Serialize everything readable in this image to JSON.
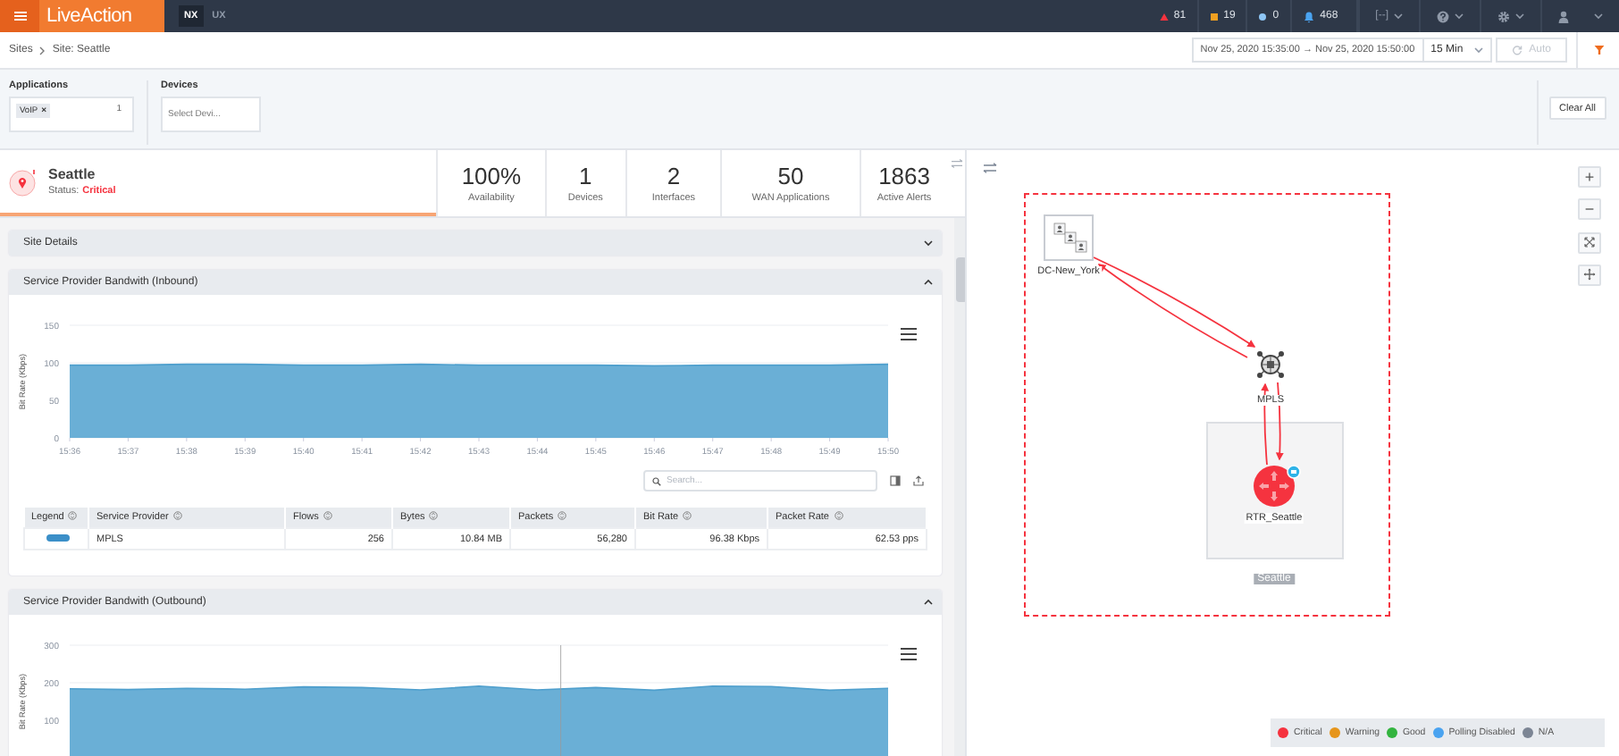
{
  "top_bar": {
    "logo": "LiveAction",
    "tabs": [
      {
        "label": "NX",
        "selected": true
      },
      {
        "label": "UX",
        "selected": false
      }
    ],
    "alerts": [
      {
        "kind": "critical",
        "count": "81"
      },
      {
        "kind": "warning",
        "count": "19"
      },
      {
        "kind": "info",
        "count": "0"
      },
      {
        "kind": "notifications",
        "count": "468"
      }
    ],
    "bracket_menu": "[--]"
  },
  "breadcrumb": [
    "Sites",
    "Site: Seattle"
  ],
  "time_range": {
    "value": "Nov 25, 2020 15:35:00 → Nov 25, 2020 15:50:00",
    "interval": "15 Min",
    "auto": {
      "label": "Auto",
      "disabled": true
    }
  },
  "filters": {
    "applications": {
      "label": "Applications",
      "chips": [
        {
          "label": "VoIP",
          "remove": "×"
        }
      ],
      "count": "1"
    },
    "devices": {
      "label": "Devices",
      "placeholder": "Select Devi..."
    },
    "clear_button": "Clear All"
  },
  "site": {
    "name": "Seattle",
    "status_label": "Status:",
    "status": "Critical"
  },
  "stats": [
    {
      "value": "100%",
      "label": "Availability"
    },
    {
      "value": "1",
      "label": "Devices"
    },
    {
      "value": "2",
      "label": "Interfaces"
    },
    {
      "value": "50",
      "label": "WAN Applications"
    },
    {
      "value": "1863",
      "label": "Active Alerts"
    }
  ],
  "panels": [
    {
      "kind": "collapsed",
      "title": "Site Details",
      "expanded": false
    },
    {
      "kind": "chart_table",
      "title": "Service Provider Bandwith (Inbound)",
      "expanded": true,
      "chart_data": {
        "type": "area",
        "ylabel": "Bit Rate (Kbps)",
        "categories": [
          "15:36",
          "15:37",
          "15:38",
          "15:39",
          "15:40",
          "15:41",
          "15:42",
          "15:43",
          "15:44",
          "15:45",
          "15:46",
          "15:47",
          "15:48",
          "15:49",
          "15:50"
        ],
        "series": [
          {
            "color": "#6aafd6",
            "values": [
              97,
              97,
              98,
              98,
              97,
              97,
              98,
              97,
              97,
              97,
              96,
              97,
              97,
              97,
              98
            ]
          }
        ],
        "ylim": [
          0,
          150
        ],
        "yticks": [
          0,
          50,
          100,
          150
        ]
      },
      "search_placeholder": "Search...",
      "table": {
        "columns": [
          "Legend",
          "Service Provider",
          "Flows",
          "Bytes",
          "Packets",
          "Bit Rate",
          "Packet Rate"
        ],
        "rows": [
          {
            "color": "#3b8fc8",
            "provider": "MPLS",
            "flows": "256",
            "bytes": "10.84 MB",
            "packets": "56,280",
            "bit_rate": "96.38 Kbps",
            "packet_rate": "62.53 pps"
          }
        ]
      }
    },
    {
      "kind": "chart",
      "title": "Service Provider Bandwith (Outbound)",
      "expanded": true,
      "chart_data": {
        "type": "area",
        "ylabel": "Bit Rate (Kbps)",
        "series": [
          {
            "color": "#6aafd6",
            "values": [
              184,
              182,
              185,
              183,
              189,
              187,
              181,
              191,
              181,
              187,
              180,
              191,
              190,
              180,
              185
            ]
          }
        ],
        "ylim": [
          0,
          300
        ],
        "yticks": [
          100,
          200,
          300
        ]
      }
    }
  ],
  "topology": {
    "nodes": [
      {
        "kind": "site_group",
        "name": "DC-New_York"
      },
      {
        "kind": "cloud",
        "name": "MPLS"
      },
      {
        "kind": "router",
        "name": "RTR_Seattle",
        "color": "#f5333f"
      }
    ],
    "group_label": "Seattle",
    "zoom_controls": [
      "+",
      "−"
    ],
    "legend": [
      {
        "label": "Critical",
        "color": "#f5333f"
      },
      {
        "label": "Warning",
        "color": "#e6951b"
      },
      {
        "label": "Good",
        "color": "#33b43f"
      },
      {
        "label": "Polling Disabled",
        "color": "#4aa3f0"
      },
      {
        "label": "N/A",
        "color": "#7c8594"
      }
    ]
  }
}
